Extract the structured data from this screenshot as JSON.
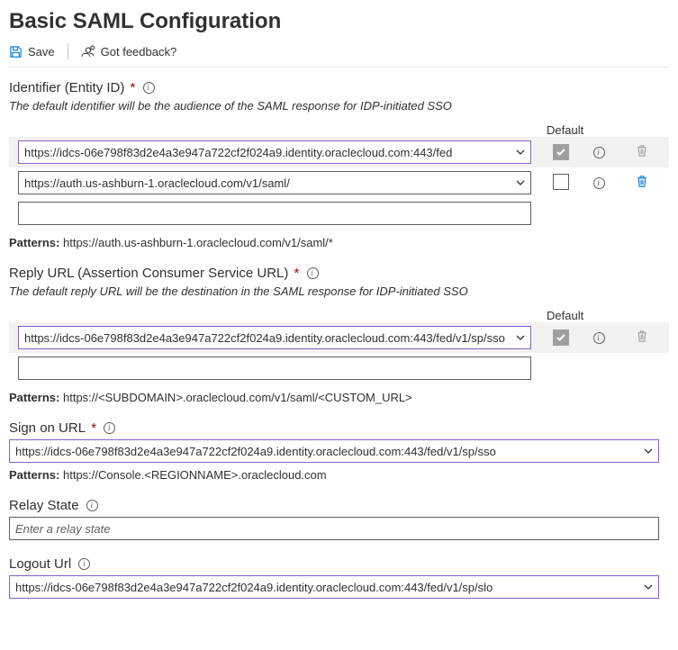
{
  "page_title": "Basic SAML Configuration",
  "toolbar": {
    "save_label": "Save",
    "feedback_label": "Got feedback?"
  },
  "identifier": {
    "label": "Identifier (Entity ID)",
    "desc": "The default identifier will be the audience of the SAML response for IDP-initiated SSO",
    "default_header": "Default",
    "rows": [
      {
        "value": "https://idcs-06e798f83d2e4a3e947a722cf2f024a9.identity.oraclecloud.com:443/fed",
        "default": true,
        "deletable": false
      },
      {
        "value": "https://auth.us-ashburn-1.oraclecloud.com/v1/saml/",
        "default": false,
        "deletable": true
      }
    ],
    "blank": "",
    "patterns_label": "Patterns:",
    "patterns_value": "https://auth.us-ashburn-1.oraclecloud.com/v1/saml/*"
  },
  "reply": {
    "label": "Reply URL (Assertion Consumer Service URL)",
    "desc": "The default reply URL will be the destination in the SAML response for IDP-initiated SSO",
    "default_header": "Default",
    "rows": [
      {
        "value": "https://idcs-06e798f83d2e4a3e947a722cf2f024a9.identity.oraclecloud.com:443/fed/v1/sp/sso",
        "default": true,
        "deletable": false
      }
    ],
    "blank": "",
    "patterns_label": "Patterns:",
    "patterns_value": "https://<SUBDOMAIN>.oraclecloud.com/v1/saml/<CUSTOM_URL>"
  },
  "signon": {
    "label": "Sign on URL",
    "value": "https://idcs-06e798f83d2e4a3e947a722cf2f024a9.identity.oraclecloud.com:443/fed/v1/sp/sso",
    "patterns_label": "Patterns:",
    "patterns_value": "https://Console.<REGIONNAME>.oraclecloud.com"
  },
  "relay": {
    "label": "Relay State",
    "placeholder": "Enter a relay state",
    "value": ""
  },
  "logout": {
    "label": "Logout Url",
    "value": "https://idcs-06e798f83d2e4a3e947a722cf2f024a9.identity.oraclecloud.com:443/fed/v1/sp/slo"
  }
}
